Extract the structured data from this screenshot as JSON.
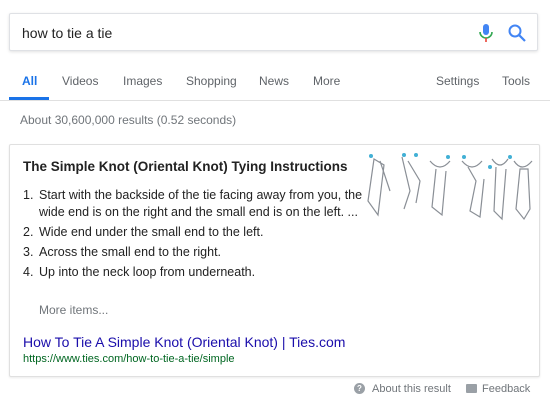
{
  "search": {
    "query": "how to tie a tie"
  },
  "tabs": [
    {
      "label": "All",
      "active": true
    },
    {
      "label": "Videos"
    },
    {
      "label": "Images"
    },
    {
      "label": "Shopping"
    },
    {
      "label": "News"
    },
    {
      "label": "More"
    }
  ],
  "tools": {
    "settings": "Settings",
    "tools": "Tools"
  },
  "stats": "About 30,600,000 results (0.52 seconds)",
  "snippet": {
    "title": "The Simple Knot (Oriental Knot) Tying Instructions",
    "steps": [
      {
        "num": "1.",
        "text": "Start with the backside of the tie facing away from you, the wide end is on the right and the small end is on the left. ..."
      },
      {
        "num": "2.",
        "text": "Wide end under the small end to the left."
      },
      {
        "num": "3.",
        "text": "Across the small end to the right."
      },
      {
        "num": "4.",
        "text": "Up into the neck loop from underneath."
      }
    ],
    "more_items": "More items...",
    "link_title": "How To Tie A Simple Knot (Oriental Knot) | Ties.com",
    "url": "https://www.ties.com/how-to-tie-a-tie/simple",
    "image_icon": "tie-knot-diagram"
  },
  "footer": {
    "about": "About this result",
    "feedback": "Feedback"
  },
  "colors": {
    "accent": "#1a73e8",
    "link": "#1a0dab",
    "url": "#006621",
    "muted": "#70757a"
  }
}
